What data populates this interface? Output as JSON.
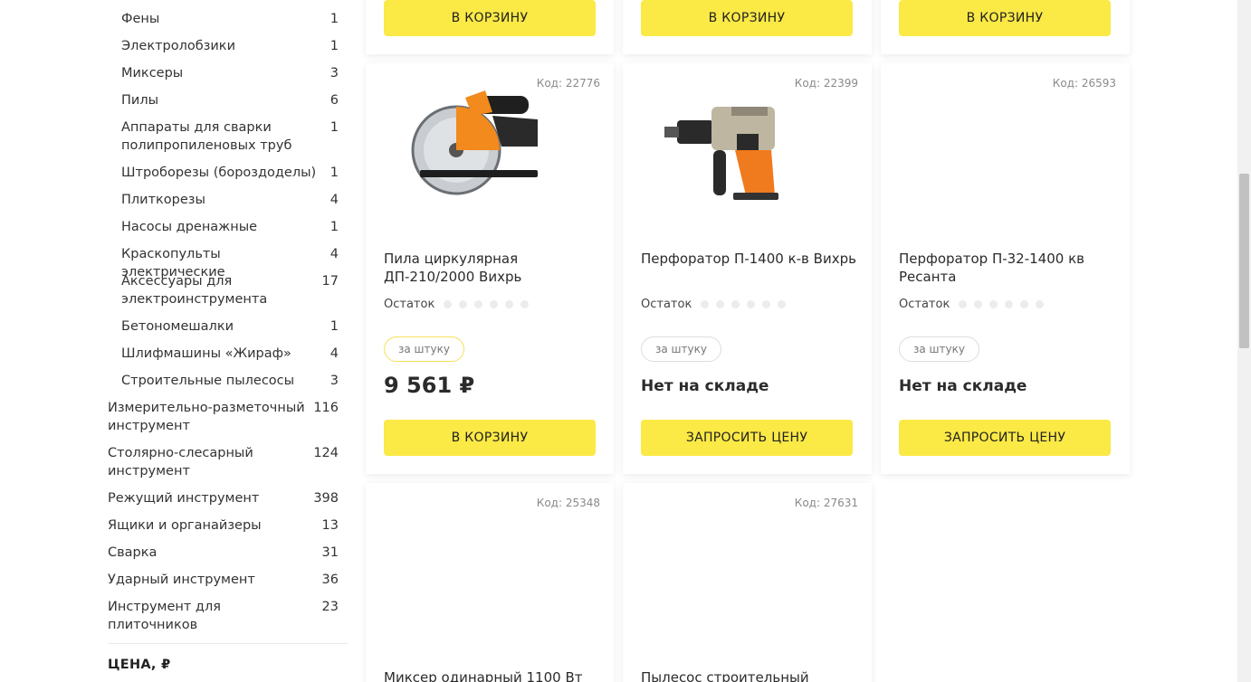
{
  "sidebar": {
    "sub_categories": [
      {
        "name": "Фены",
        "count": "1"
      },
      {
        "name": "Электролобзики",
        "count": "1"
      },
      {
        "name": "Миксеры",
        "count": "3"
      },
      {
        "name": "Пилы",
        "count": "6"
      },
      {
        "name": "Аппараты для сварки полипропиленовых труб",
        "count": "1"
      },
      {
        "name": "Штроборезы (бороздоделы)",
        "count": "1"
      },
      {
        "name": "Плиткорезы",
        "count": "4"
      },
      {
        "name": "Насосы дренажные",
        "count": "1"
      },
      {
        "name": "Краскопульты электрические",
        "count": "4"
      },
      {
        "name": "Аксессуары для электроинструмента",
        "count": "17"
      },
      {
        "name": "Бетономешалки",
        "count": "1"
      },
      {
        "name": "Шлифмашины «Жираф»",
        "count": "4"
      },
      {
        "name": "Строительные пылесосы",
        "count": "3"
      }
    ],
    "top_categories": [
      {
        "name": "Измерительно-разметочный инструмент",
        "count": "116"
      },
      {
        "name": "Столярно-слесарный инструмент",
        "count": "124"
      },
      {
        "name": "Режущий инструмент",
        "count": "398"
      },
      {
        "name": "Ящики и органайзеры",
        "count": "13"
      },
      {
        "name": "Сварка",
        "count": "31"
      },
      {
        "name": "Ударный инструмент",
        "count": "36"
      },
      {
        "name": "Инструмент для плиточников",
        "count": "23"
      }
    ],
    "price_heading": "ЦЕНА, ₽"
  },
  "top_row_buttons": [
    "В КОРЗИНУ",
    "В КОРЗИНУ",
    "В КОРЗИНУ"
  ],
  "products": [
    {
      "code": "Код: 22776",
      "title": "Пила циркулярная ДП-210/2000 Вихрь",
      "stock_label": "Остаток",
      "unit": "за штуку",
      "price": "9 561 ₽",
      "button": "В КОРЗИНУ",
      "image": "circular-saw"
    },
    {
      "code": "Код: 22399",
      "title": "Перфоратор П-1400 к-в Вихрь",
      "stock_label": "Остаток",
      "unit": "за штуку",
      "availability": "Нет на складе",
      "button": "ЗАПРОСИТЬ ЦЕНУ",
      "image": "rotary-hammer"
    },
    {
      "code": "Код: 26593",
      "title": "Перфоратор П-32-1400 кв Ресанта",
      "stock_label": "Остаток",
      "unit": "за штуку",
      "availability": "Нет на складе",
      "button": "ЗАПРОСИТЬ ЦЕНУ",
      "image": ""
    },
    {
      "code": "Код: 25348",
      "title": "Миксер одинарный 1100 Вт"
    },
    {
      "code": "Код: 27631",
      "title": "Пылесос строительный"
    }
  ],
  "colors": {
    "accent_yellow": "#fbe946",
    "text": "#2b2b2b",
    "muted": "#8a8a8a"
  }
}
